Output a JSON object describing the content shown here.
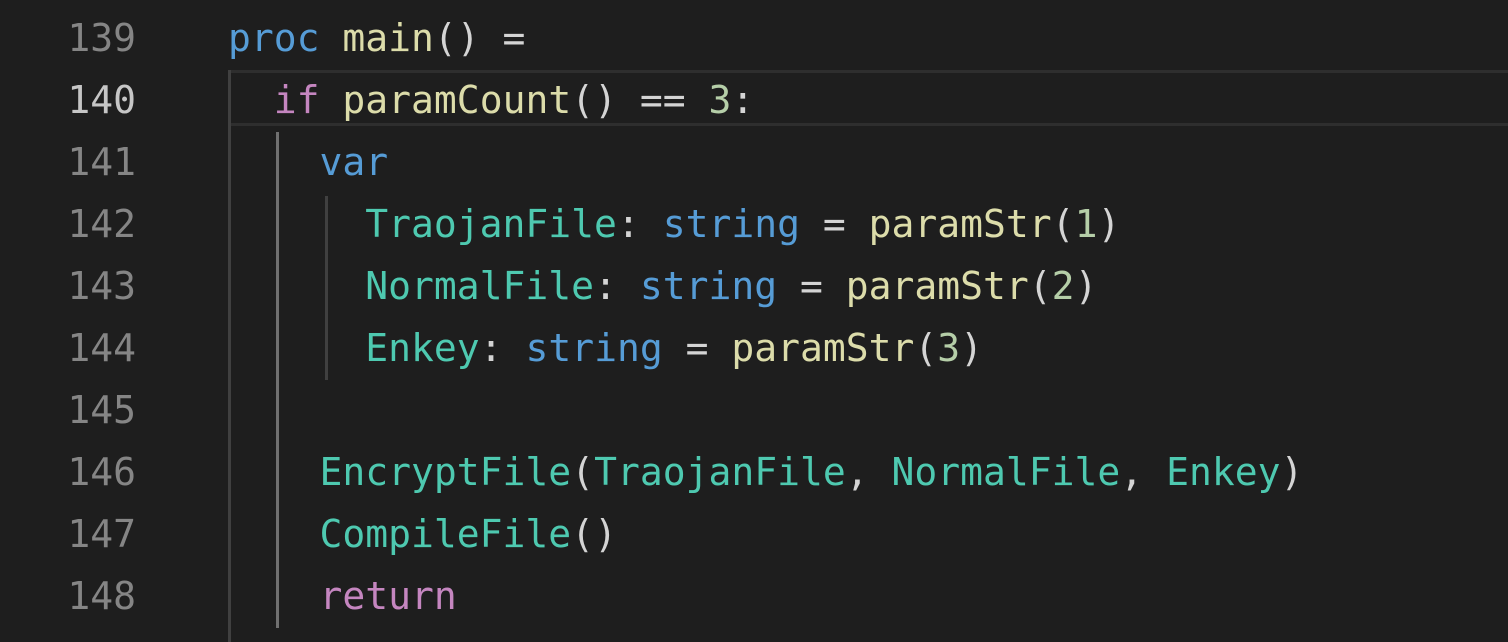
{
  "editor": {
    "colors": {
      "background": "#1e1e1e",
      "line_number": "#858585",
      "line_number_active": "#c6c6c6",
      "keyword": "#569cd6",
      "control": "#c586c0",
      "function": "#dcdcaa",
      "type": "#4ec9b0",
      "number": "#b5cea8",
      "punctuation": "#d4d4d4"
    },
    "active_line": "140",
    "lines": [
      {
        "number": "139",
        "tokens": [
          {
            "text": "proc",
            "kind": "kw"
          },
          {
            "text": " ",
            "kind": "punct"
          },
          {
            "text": "main",
            "kind": "fn"
          },
          {
            "text": "() =",
            "kind": "punct"
          }
        ]
      },
      {
        "number": "140",
        "tokens": [
          {
            "text": "  ",
            "kind": "punct"
          },
          {
            "text": "if",
            "kind": "ctrl"
          },
          {
            "text": " ",
            "kind": "punct"
          },
          {
            "text": "paramCount",
            "kind": "fn"
          },
          {
            "text": "() == ",
            "kind": "punct"
          },
          {
            "text": "3",
            "kind": "num"
          },
          {
            "text": ":",
            "kind": "punct"
          }
        ]
      },
      {
        "number": "141",
        "tokens": [
          {
            "text": "    ",
            "kind": "punct"
          },
          {
            "text": "var",
            "kind": "kw"
          }
        ]
      },
      {
        "number": "142",
        "tokens": [
          {
            "text": "      ",
            "kind": "punct"
          },
          {
            "text": "TraojanFile",
            "kind": "type"
          },
          {
            "text": ": ",
            "kind": "punct"
          },
          {
            "text": "string",
            "kind": "kw"
          },
          {
            "text": " = ",
            "kind": "punct"
          },
          {
            "text": "paramStr",
            "kind": "fn"
          },
          {
            "text": "(",
            "kind": "punct"
          },
          {
            "text": "1",
            "kind": "num"
          },
          {
            "text": ")",
            "kind": "punct"
          }
        ]
      },
      {
        "number": "143",
        "tokens": [
          {
            "text": "      ",
            "kind": "punct"
          },
          {
            "text": "NormalFile",
            "kind": "type"
          },
          {
            "text": ": ",
            "kind": "punct"
          },
          {
            "text": "string",
            "kind": "kw"
          },
          {
            "text": " = ",
            "kind": "punct"
          },
          {
            "text": "paramStr",
            "kind": "fn"
          },
          {
            "text": "(",
            "kind": "punct"
          },
          {
            "text": "2",
            "kind": "num"
          },
          {
            "text": ")",
            "kind": "punct"
          }
        ]
      },
      {
        "number": "144",
        "tokens": [
          {
            "text": "      ",
            "kind": "punct"
          },
          {
            "text": "Enkey",
            "kind": "type"
          },
          {
            "text": ": ",
            "kind": "punct"
          },
          {
            "text": "string",
            "kind": "kw"
          },
          {
            "text": " = ",
            "kind": "punct"
          },
          {
            "text": "paramStr",
            "kind": "fn"
          },
          {
            "text": "(",
            "kind": "punct"
          },
          {
            "text": "3",
            "kind": "num"
          },
          {
            "text": ")",
            "kind": "punct"
          }
        ]
      },
      {
        "number": "145",
        "tokens": []
      },
      {
        "number": "146",
        "tokens": [
          {
            "text": "    ",
            "kind": "punct"
          },
          {
            "text": "EncryptFile",
            "kind": "type"
          },
          {
            "text": "(",
            "kind": "punct"
          },
          {
            "text": "TraojanFile",
            "kind": "type"
          },
          {
            "text": ", ",
            "kind": "punct"
          },
          {
            "text": "NormalFile",
            "kind": "type"
          },
          {
            "text": ", ",
            "kind": "punct"
          },
          {
            "text": "Enkey",
            "kind": "type"
          },
          {
            "text": ")",
            "kind": "punct"
          }
        ]
      },
      {
        "number": "147",
        "tokens": [
          {
            "text": "    ",
            "kind": "punct"
          },
          {
            "text": "CompileFile",
            "kind": "type"
          },
          {
            "text": "()",
            "kind": "punct"
          }
        ]
      },
      {
        "number": "148",
        "tokens": [
          {
            "text": "    ",
            "kind": "punct"
          },
          {
            "text": "return",
            "kind": "ctrl"
          }
        ]
      }
    ]
  }
}
